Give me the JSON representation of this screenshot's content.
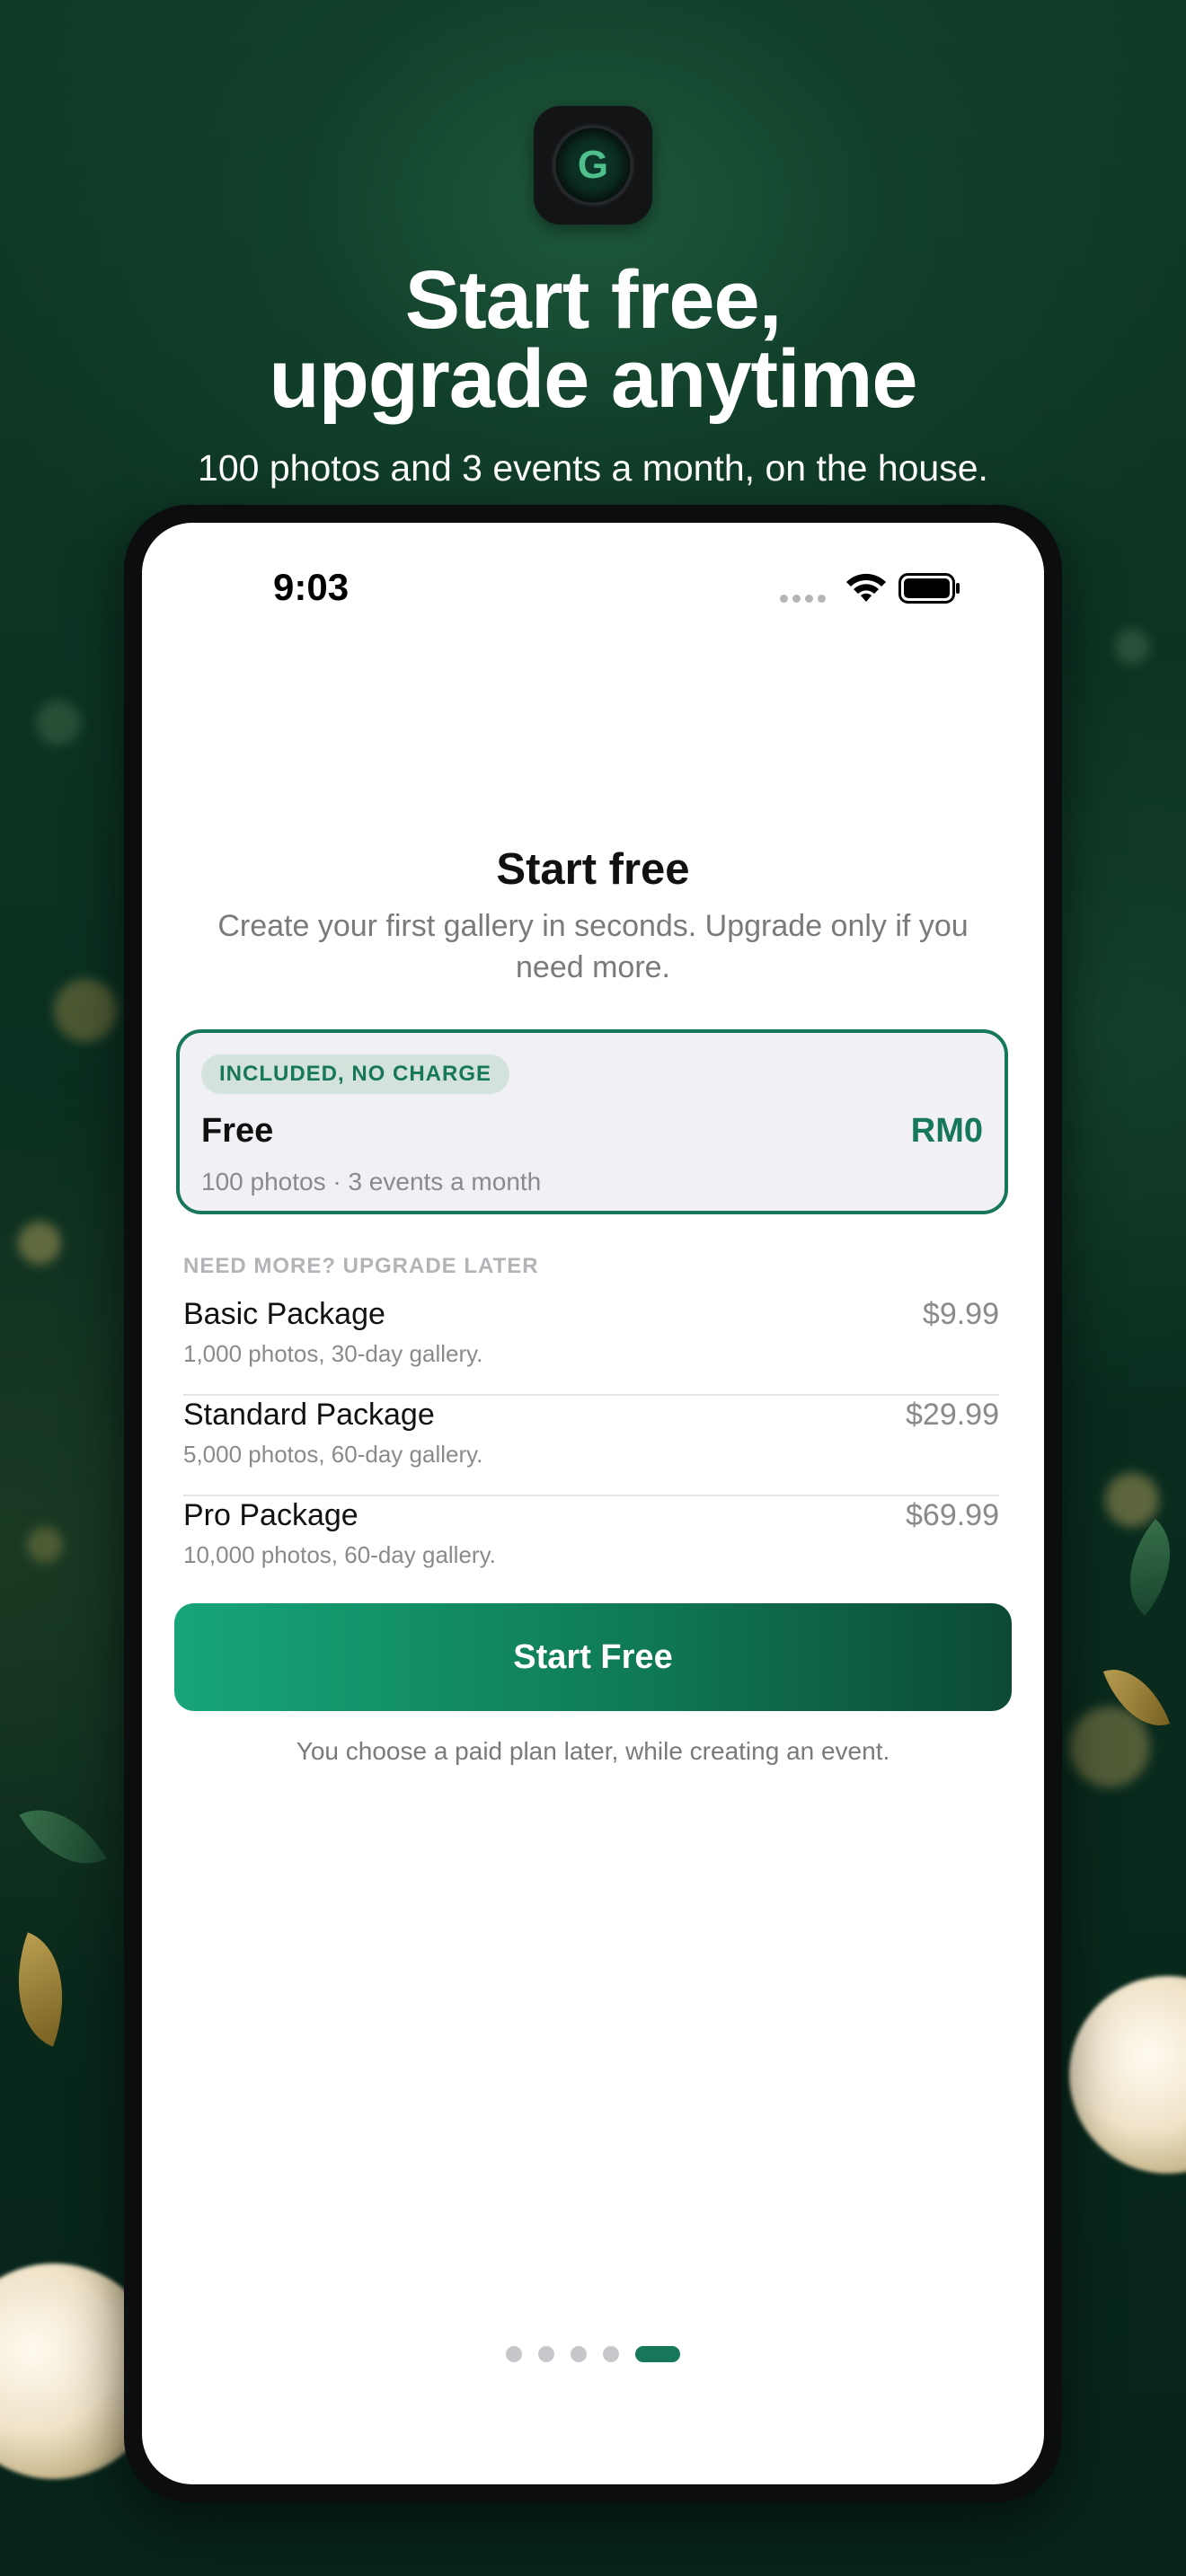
{
  "marketing": {
    "headline_line1": "Start free,",
    "headline_line2": "upgrade anytime",
    "subline": "100 photos and 3 events a month, on the house."
  },
  "status_bar": {
    "time": "9:03"
  },
  "screen": {
    "title": "Start free",
    "subtitle": "Create your first gallery in seconds. Upgrade only if you need more."
  },
  "free_plan": {
    "badge": "INCLUDED, NO CHARGE",
    "name": "Free",
    "price": "RM0",
    "description": "100 photos · 3 events a month"
  },
  "upgrade_section": {
    "label": "NEED MORE? UPGRADE LATER",
    "plans": [
      {
        "name": "Basic Package",
        "description": "1,000 photos, 30-day gallery.",
        "price": "$9.99"
      },
      {
        "name": "Standard Package",
        "description": "5,000 photos, 60-day gallery.",
        "price": "$29.99"
      },
      {
        "name": "Pro Package",
        "description": "10,000 photos, 60-day gallery.",
        "price": "$69.99"
      }
    ]
  },
  "cta": {
    "label": "Start Free",
    "footnote": "You choose a paid plan later, while creating an event."
  },
  "pager": {
    "total": 5,
    "active": 5
  },
  "colors": {
    "accent": "#17775A",
    "cta_start": "#17A57A",
    "cta_end": "#0C4A33",
    "background": "#0B2A1D"
  }
}
